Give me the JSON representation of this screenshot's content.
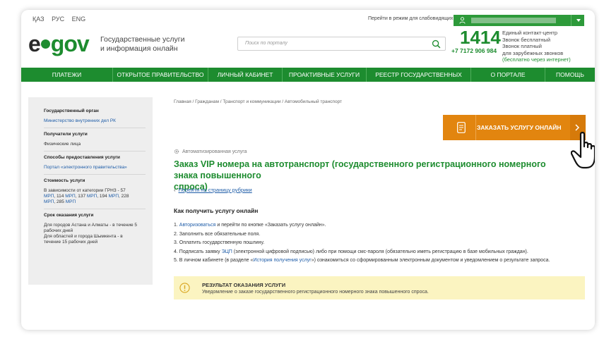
{
  "topbar": {
    "langs": [
      "ҚАЗ",
      "РУС",
      "ENG"
    ],
    "accessibility_link": "Перейти в режим для слабовидящих"
  },
  "header": {
    "logo_left": "e",
    "logo_right": "gov",
    "logo_sub_line1": "Государственные услуги",
    "logo_sub_line2": "и информация онлайн",
    "search_placeholder": "Поиск по порталу",
    "phone_number": "1414",
    "phone_alt": "+7 7172 906 984",
    "phone_info_line1": "Единый контакт-центр",
    "phone_info_line2": "Звонок бесплатный",
    "phone_info_line3": "Звонок платный",
    "phone_info_line4": "для зарубежных звонков",
    "phone_info_line5": "(бесплатно через интернет)"
  },
  "nav": {
    "items": [
      "ПЛАТЕЖИ",
      "ОТКРЫТОЕ ПРАВИТЕЛЬСТВО",
      "ЛИЧНЫЙ КАБИНЕТ",
      "ПРОАКТИВНЫЕ УСЛУГИ",
      "РЕЕСТР ГОСУДАРСТВЕННЫХ УСЛУГ",
      "О ПОРТАЛЕ",
      "ПОМОЩЬ"
    ]
  },
  "sidebar": {
    "gov_body_title": "Государственный орган",
    "gov_body_value": "Министерство внутренних дел РК",
    "recipients_title": "Получатели услуги",
    "recipients_value": "Физические лица",
    "methods_title": "Способы предоставления услуги",
    "methods_value": "Портал «электронного правительства»",
    "cost_title": "Стоимость услуги",
    "cost_line1": "В зависимости от категории ГРНЗ - 57",
    "cost_line2_mrp1": "МРП",
    "cost_line2_a": ", 114 ",
    "cost_line2_mrp2": "МРП",
    "cost_line2_b": ", 137 ",
    "cost_line2_mrp3": "МРП",
    "cost_line2_c": ", 194 ",
    "cost_line2_mrp4": "МРП",
    "cost_line2_d": ", 228",
    "cost_line3_mrp": "МРП",
    "cost_line3_a": ", 285 ",
    "cost_line3_mrp2": "МРП",
    "term_title": "Срок оказания услуги",
    "term_line1": "Для городов Астана и Алматы - в течение 5",
    "term_line2": "рабочих дней",
    "term_line3": "Для областей и города Шымкента - в",
    "term_line4": "течение 15 рабочих дней"
  },
  "main": {
    "breadcrumb": "Главная / Гражданам / Транспорт и коммуникации / Автомобильный транспорт",
    "order_button_label": "ЗАКАЗАТЬ УСЛУГУ ОНЛАЙН",
    "auto_label": "Автоматизированная услуга",
    "title_line1": "Заказ VIP номера на автотранспорт (государственного регистрационного номерного знака повышенного",
    "title_line2": "спроса)",
    "back_link": "Перейти на страницу рубрики",
    "how_title": "Как получить услугу онлайн",
    "step1_a": "1. ",
    "step1_link": "Авторизоваться",
    "step1_b": " и перейти по кнопке «Заказать услугу онлайн».",
    "step2": "2. Заполнить все обязательные поля.",
    "step3": "3. Оплатить государственную пошлину.",
    "step4_a": "4. Подписать заявку ",
    "step4_link": "ЭЦП",
    "step4_b": " (электронной цифровой подписью) либо при помощи смс-пароля (обязательно иметь регистрацию в базе мобильных граждан).",
    "step5_a": "5. В личном кабинете (в разделе «",
    "step5_link": "История получения услуг",
    "step5_b": "») ознакомиться со сформированным электронным документом и уведомлением о результате запроса.",
    "result_title": "РЕЗУЛЬТАТ ОКАЗАНИЯ УСЛУГИ",
    "result_text": "Уведомление о заказе государственного регистрационного номерного знака повышенного спроса."
  },
  "colors": {
    "brand_green": "#1d8c2f",
    "accent_orange": "#e2850f",
    "link_blue": "#1f5da8",
    "result_bg": "#fbf4c1"
  }
}
